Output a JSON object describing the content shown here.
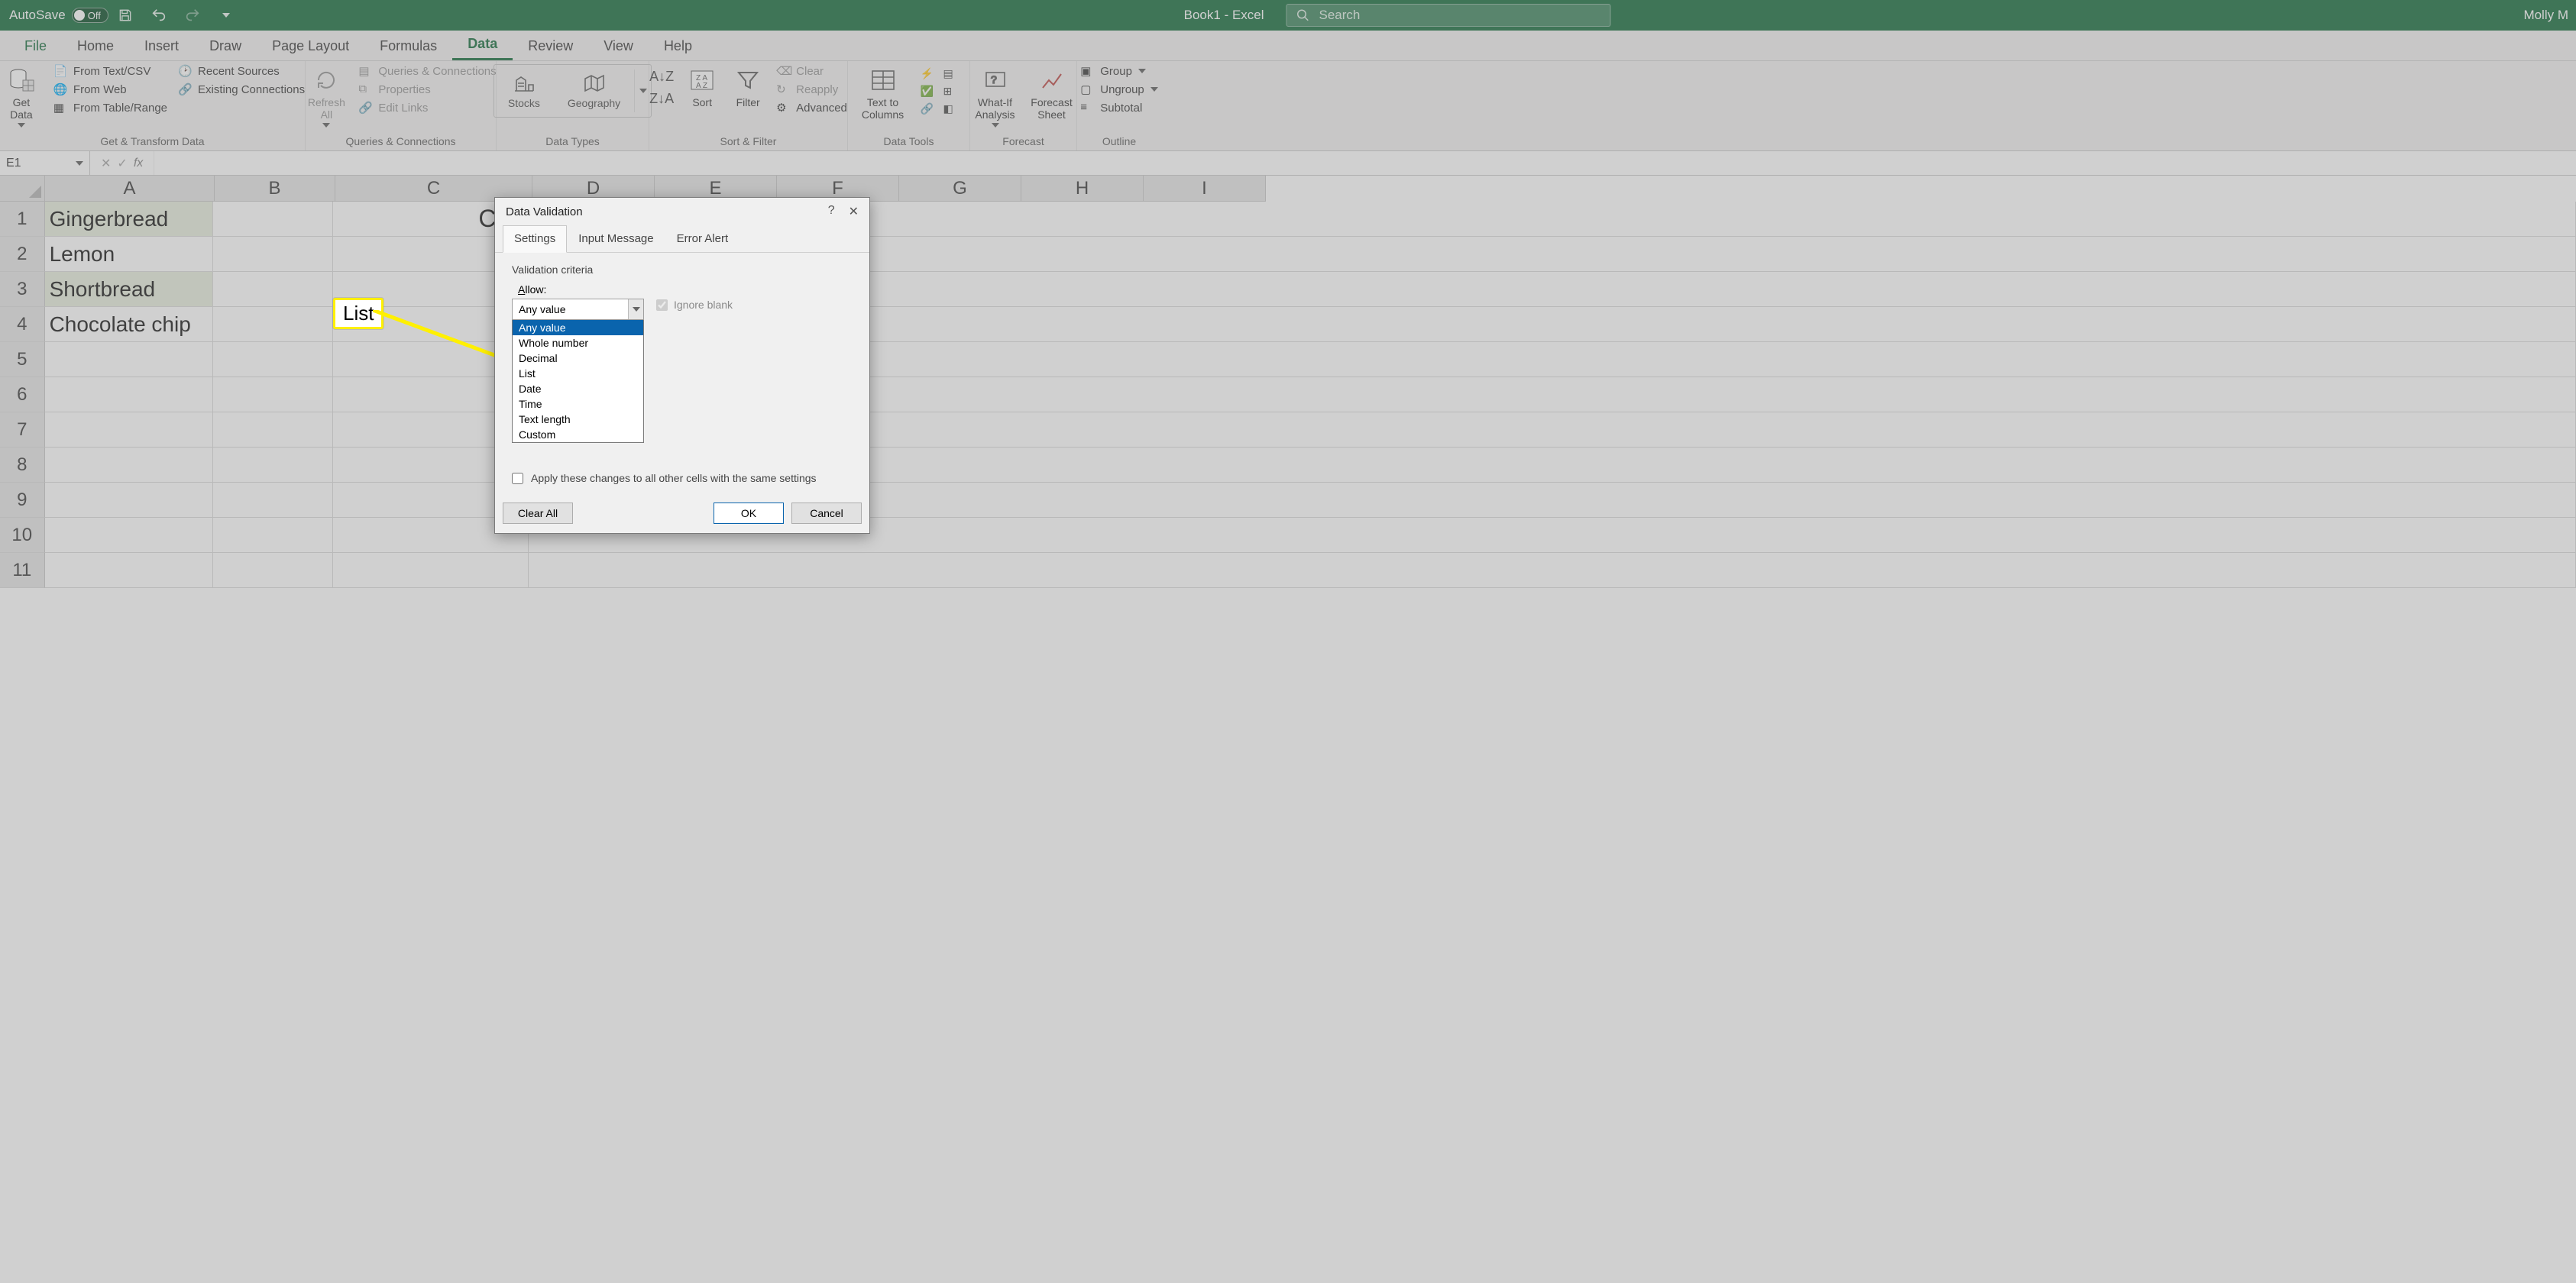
{
  "titlebar": {
    "autosave_label": "AutoSave",
    "autosave_state": "Off",
    "doc_title": "Book1  -  Excel",
    "search_placeholder": "Search",
    "user_name": "Molly M"
  },
  "ribbon": {
    "tabs": [
      "File",
      "Home",
      "Insert",
      "Draw",
      "Page Layout",
      "Formulas",
      "Data",
      "Review",
      "View",
      "Help"
    ],
    "active_tab": "Data",
    "groups": {
      "get_transform": {
        "label": "Get & Transform Data",
        "get_data": "Get\nData",
        "items_col1": [
          "From Text/CSV",
          "From Web",
          "From Table/Range"
        ],
        "items_col2": [
          "Recent Sources",
          "Existing Connections"
        ]
      },
      "queries": {
        "label": "Queries & Connections",
        "refresh": "Refresh\nAll",
        "items": [
          "Queries & Connections",
          "Properties",
          "Edit Links"
        ]
      },
      "data_types": {
        "label": "Data Types",
        "items": [
          "Stocks",
          "Geography"
        ]
      },
      "sort_filter": {
        "label": "Sort & Filter",
        "sort": "Sort",
        "filter": "Filter",
        "items": [
          "Clear",
          "Reapply",
          "Advanced"
        ]
      },
      "data_tools": {
        "label": "Data Tools",
        "text_to_cols": "Text to\nColumns"
      },
      "forecast": {
        "label": "Forecast",
        "whatif": "What-If\nAnalysis",
        "forecast_sheet": "Forecast\nSheet"
      },
      "outline": {
        "label": "Outline",
        "items": [
          "Group",
          "Ungroup",
          "Subtotal"
        ]
      }
    }
  },
  "formula_bar": {
    "name_box": "E1",
    "fx": "fx"
  },
  "grid": {
    "columns": [
      "A",
      "B",
      "C",
      "D",
      "E",
      "F",
      "G",
      "H",
      "I"
    ],
    "rows": [
      1,
      2,
      3,
      4,
      5,
      6,
      7,
      8,
      9,
      10,
      11
    ],
    "data": {
      "A1": "Gingerbread",
      "A2": "Lemon",
      "A3": "Shortbread",
      "A4": "Chocolate chip",
      "C1": "Coo"
    }
  },
  "dialog": {
    "title": "Data Validation",
    "tabs": [
      "Settings",
      "Input Message",
      "Error Alert"
    ],
    "active_tab": "Settings",
    "criteria_label": "Validation criteria",
    "allow_label": "Allow:",
    "allow_selected": "Any value",
    "allow_options": [
      "Any value",
      "Whole number",
      "Decimal",
      "List",
      "Date",
      "Time",
      "Text length",
      "Custom"
    ],
    "ignore_blank": "Ignore blank",
    "apply_label": "Apply these changes to all other cells with the same settings",
    "clear_all": "Clear All",
    "ok": "OK",
    "cancel": "Cancel"
  },
  "callout": {
    "text": "List"
  }
}
